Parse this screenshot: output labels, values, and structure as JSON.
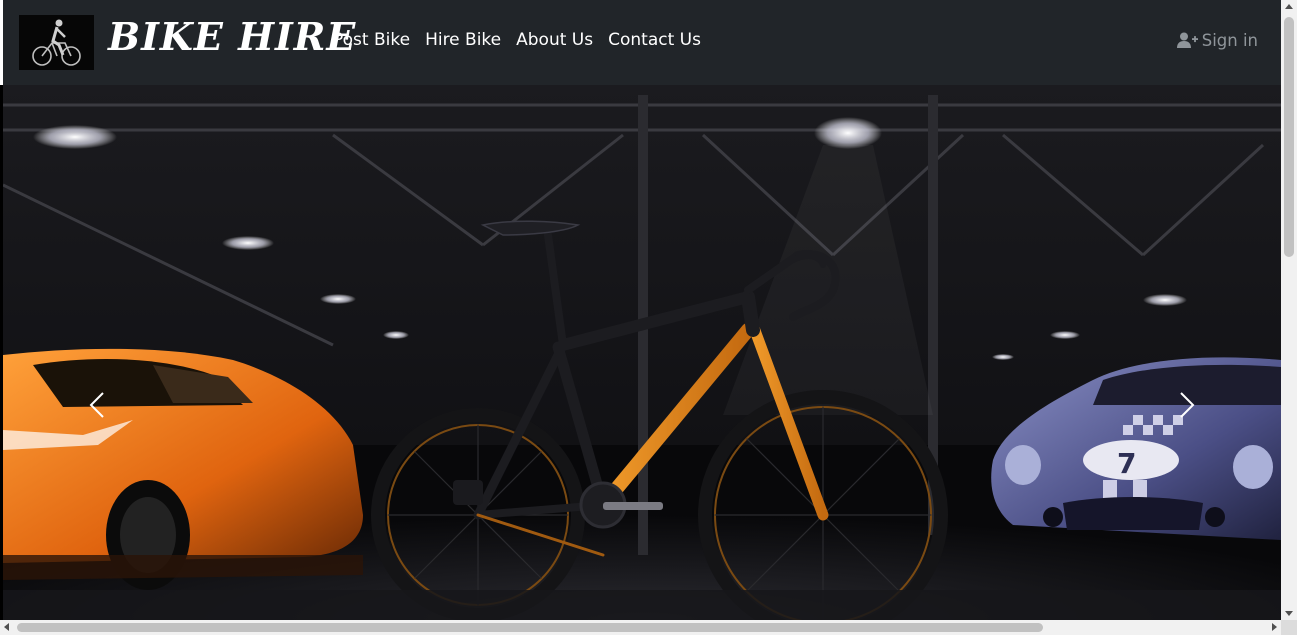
{
  "navbar": {
    "brand": "BIKE HIRE",
    "links": [
      "Post Bike",
      "Hire Bike",
      "About Us",
      "Contact Us"
    ],
    "signin_label": "Sign in",
    "signin_icon": "user-plus-icon",
    "background": "#212529",
    "signin_color": "#8f959a"
  },
  "carousel": {
    "prev_icon": "chevron-left-icon",
    "next_icon": "chevron-right-icon"
  }
}
